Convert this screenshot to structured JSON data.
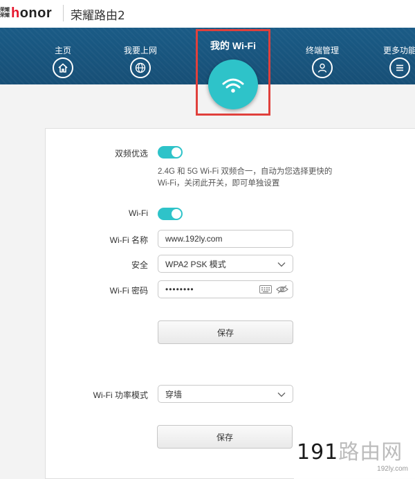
{
  "header": {
    "brand_mark_top": "荣耀",
    "brand_mark_bottom": "荣耀",
    "brand_prefix": "h",
    "brand_rest": "onor",
    "router_name": "荣耀路由2"
  },
  "nav": {
    "items": [
      {
        "label": "主页",
        "icon": "home-icon"
      },
      {
        "label": "我要上网",
        "icon": "globe-icon"
      },
      {
        "label": "终端管理",
        "icon": "user-icon"
      },
      {
        "label": "更多功能",
        "icon": "menu-icon"
      }
    ],
    "active": {
      "label": "我的 Wi-Fi",
      "icon": "wifi-icon"
    }
  },
  "settings": {
    "dual_band_label": "双频优选",
    "dual_band_on": true,
    "dual_band_desc_line1": "2.4G 和 5G Wi-Fi 双频合一，自动为您选择更快的",
    "dual_band_desc_line2": "Wi-Fi，关闭此开关，即可单独设置",
    "wifi_label": "Wi-Fi",
    "wifi_on": true,
    "ssid_label": "Wi-Fi 名称",
    "ssid_value": "www.192ly.com",
    "security_label": "安全",
    "security_value": "WPA2 PSK 模式",
    "password_label": "Wi-Fi 密码",
    "password_value": "••••••••",
    "save_label_1": "保存",
    "power_mode_label": "Wi-Fi 功率模式",
    "power_mode_value": "穿墙",
    "save_label_2": "保存"
  },
  "watermark": {
    "prefix": "191",
    "main": "路由网",
    "small": "192ly.com"
  },
  "colors": {
    "nav_bg": "#1a5b86",
    "accent_teal": "#2ec3c9",
    "highlight_red": "#e0403c",
    "brand_red": "#e6162d"
  }
}
